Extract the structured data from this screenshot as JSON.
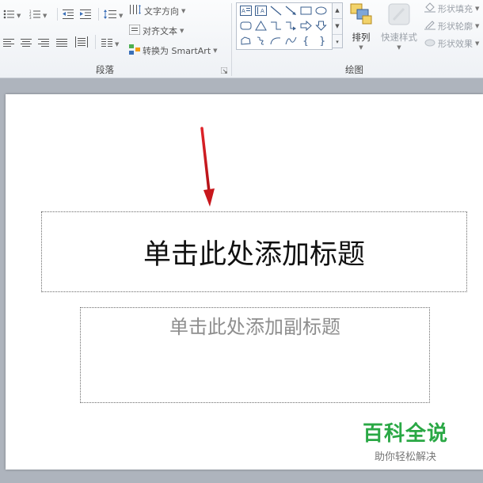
{
  "ribbon": {
    "paragraph": {
      "group_label": "段落",
      "text_direction": "文字方向",
      "align_text": "对齐文本",
      "convert_smartart": "转换为 SmartArt"
    },
    "drawing": {
      "group_label": "绘图",
      "arrange": "排列",
      "quick_styles": "快速样式",
      "shape_fill": "形状填充",
      "shape_outline": "形状轮廓",
      "shape_effects": "形状效果"
    }
  },
  "slide": {
    "title_placeholder": "单击此处添加标题",
    "subtitle_placeholder": "单击此处添加副标题"
  },
  "watermark": {
    "brand": "百科全说",
    "tagline": "助你轻松解决"
  },
  "colors": {
    "annotation_arrow": "#c8171c",
    "watermark_green": "#2aa845",
    "subtitle_gray": "#8e8e8e"
  }
}
